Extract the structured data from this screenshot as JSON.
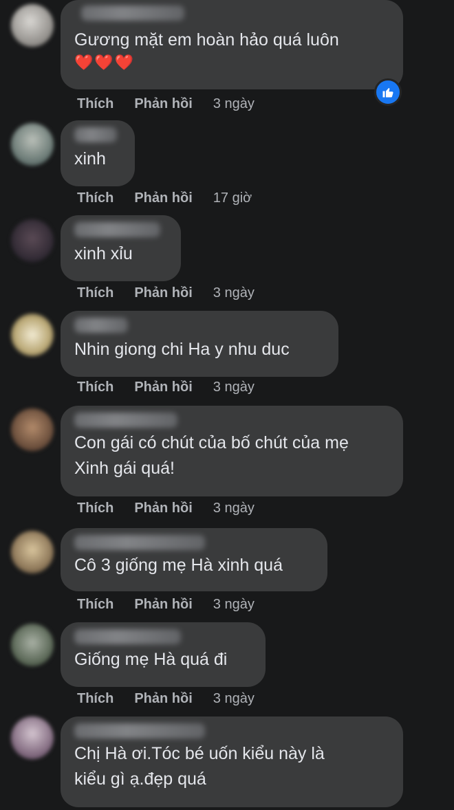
{
  "actions": {
    "like": "Thích",
    "reply": "Phản hồi"
  },
  "colors": {
    "background": "#18191a",
    "bubble": "#3a3b3c",
    "action_text": "#b0b3b8",
    "like_reaction": "#1877f2",
    "heart": "#e0245e"
  },
  "comments": [
    {
      "text": "Gương mặt em hoàn hảo quá luôn",
      "emoji": "❤️❤️❤️",
      "time": "3 ngày",
      "reaction": "like-icon"
    },
    {
      "text": "xinh",
      "time": "17 giờ"
    },
    {
      "text": "xinh xỉu",
      "time": "3 ngày"
    },
    {
      "text": "Nhin giong chi Ha y nhu duc",
      "time": "3 ngày"
    },
    {
      "text": "Con gái có chút của bố chút của mẹ\nXinh gái quá!",
      "time": "3 ngày"
    },
    {
      "text": "Cô 3 giống mẹ Hà xinh quá",
      "time": "3 ngày"
    },
    {
      "text": "Giống mẹ Hà quá đi",
      "time": "3 ngày"
    },
    {
      "text": "Chị Hà ơi.Tóc bé uốn kiểu này là\nkiểu gì ạ.đẹp quá",
      "time": ""
    }
  ]
}
